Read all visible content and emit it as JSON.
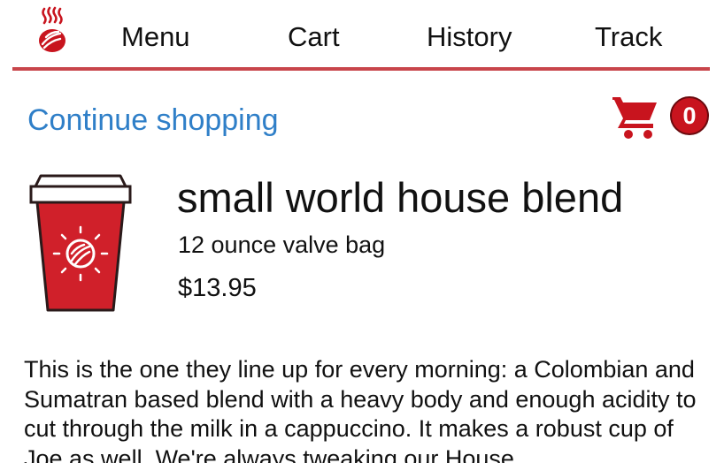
{
  "nav": {
    "items": [
      {
        "label": "Menu"
      },
      {
        "label": "Cart"
      },
      {
        "label": "History"
      },
      {
        "label": "Track"
      }
    ],
    "logo_icon": "steaming-coffee-logo-icon",
    "accent_color": "#c8454b"
  },
  "subheader": {
    "continue_label": "Continue shopping",
    "cart_icon": "shopping-cart-icon",
    "cart_count": "0"
  },
  "product": {
    "name": "small world house blend",
    "size": "12 ounce valve bag",
    "price": "$13.95",
    "image_icon": "red-coffee-cup-icon",
    "description": "This is the one they line up for every morning: a Colombian and Sumatran based blend with a heavy body and enough acidity to cut through the milk in a cappuccino. It makes a robust cup of Joe as well. We're always tweaking our House"
  },
  "colors": {
    "link": "#2f7fc8",
    "brand_red": "#c8141e"
  }
}
